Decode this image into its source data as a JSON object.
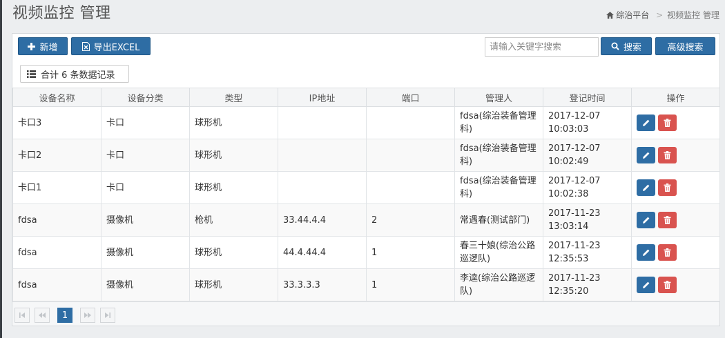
{
  "page": {
    "title": "视频监控 管理"
  },
  "breadcrumb": {
    "home": "综治平台",
    "separator": ">",
    "current": "视频监控 管理"
  },
  "toolbar": {
    "add_label": "新增",
    "export_label": "导出EXCEL",
    "search_placeholder": "请输入关键字搜索",
    "search_label": "搜索",
    "advanced_label": "高级搜索"
  },
  "summary": {
    "text": "合计 6 条数据记录"
  },
  "table": {
    "headers": [
      "设备名称",
      "设备分类",
      "类型",
      "IP地址",
      "端口",
      "管理人",
      "登记时间",
      "操作"
    ],
    "rows": [
      [
        "卡口3",
        "卡口",
        "球形机",
        "",
        "",
        "fdsa(综治装备管理科)",
        "2017-12-07 10:03:03"
      ],
      [
        "卡口2",
        "卡口",
        "球形机",
        "",
        "",
        "fdsa(综治装备管理科)",
        "2017-12-07 10:02:49"
      ],
      [
        "卡口1",
        "卡口",
        "球形机",
        "",
        "",
        "fdsa(综治装备管理科)",
        "2017-12-07 10:02:38"
      ],
      [
        "fdsa",
        "摄像机",
        "枪机",
        "33.44.4.4",
        "2",
        "常遇春(测试部门)",
        "2017-11-23 13:03:14"
      ],
      [
        "fdsa",
        "摄像机",
        "球形机",
        "44.4.44.4",
        "1",
        "春三十娘(综治公路巡逻队)",
        "2017-11-23 12:35:53"
      ],
      [
        "fdsa",
        "摄像机",
        "球形机",
        "33.3.3.3",
        "1",
        "李逵(综治公路巡逻队)",
        "2017-11-23 12:35:20"
      ]
    ]
  },
  "pagination": {
    "current_page": "1"
  },
  "colors": {
    "primary": "#2e6da4",
    "danger": "#d9534f",
    "background": "#eceef0"
  },
  "icons": [
    "home-icon",
    "plus-icon",
    "excel-icon",
    "search-icon",
    "list-icon",
    "pencil-icon",
    "trash-icon",
    "first-page-icon",
    "prev-page-icon",
    "next-page-icon",
    "last-page-icon"
  ]
}
